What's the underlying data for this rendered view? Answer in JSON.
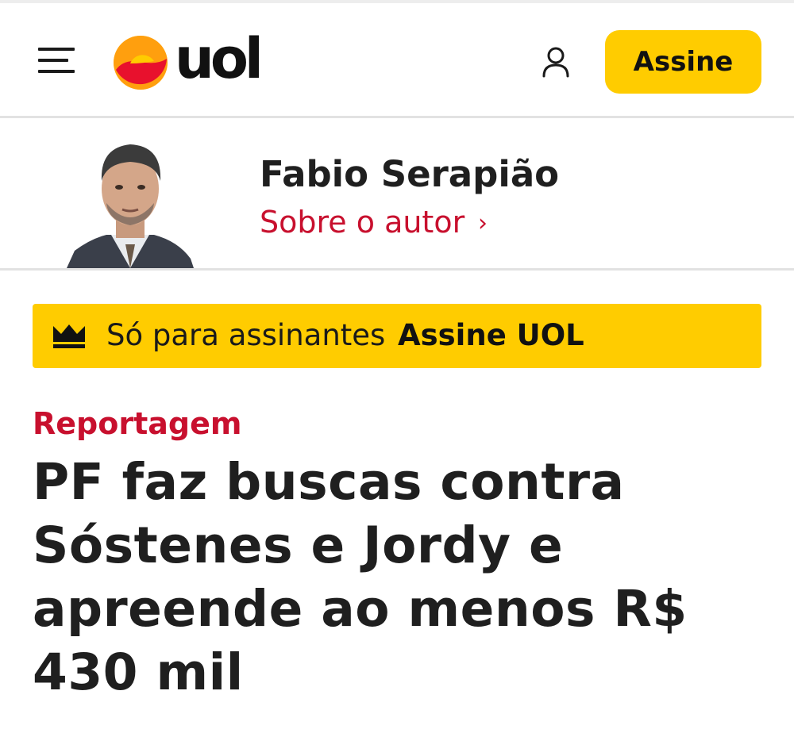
{
  "header": {
    "menu_icon": "hamburger-menu-icon",
    "logo_text": "uol",
    "account_icon": "user-icon",
    "subscribe_label": "Assine",
    "colors": {
      "accent": "#ffcc00",
      "logo_orange": "#ff8c1a",
      "logo_red": "#e8112d"
    }
  },
  "author": {
    "name": "Fabio Serapião",
    "about_label": "Sobre o autor",
    "about_chevron": "›"
  },
  "paywall": {
    "icon": "crown-icon",
    "text": "Só para assinantes",
    "link_label": "Assine UOL"
  },
  "article": {
    "category": "Reportagem",
    "headline": "PF faz buscas contra Sóstenes e Jordy e apreende ao menos R$ 430 mil",
    "category_color": "#c8102e"
  }
}
